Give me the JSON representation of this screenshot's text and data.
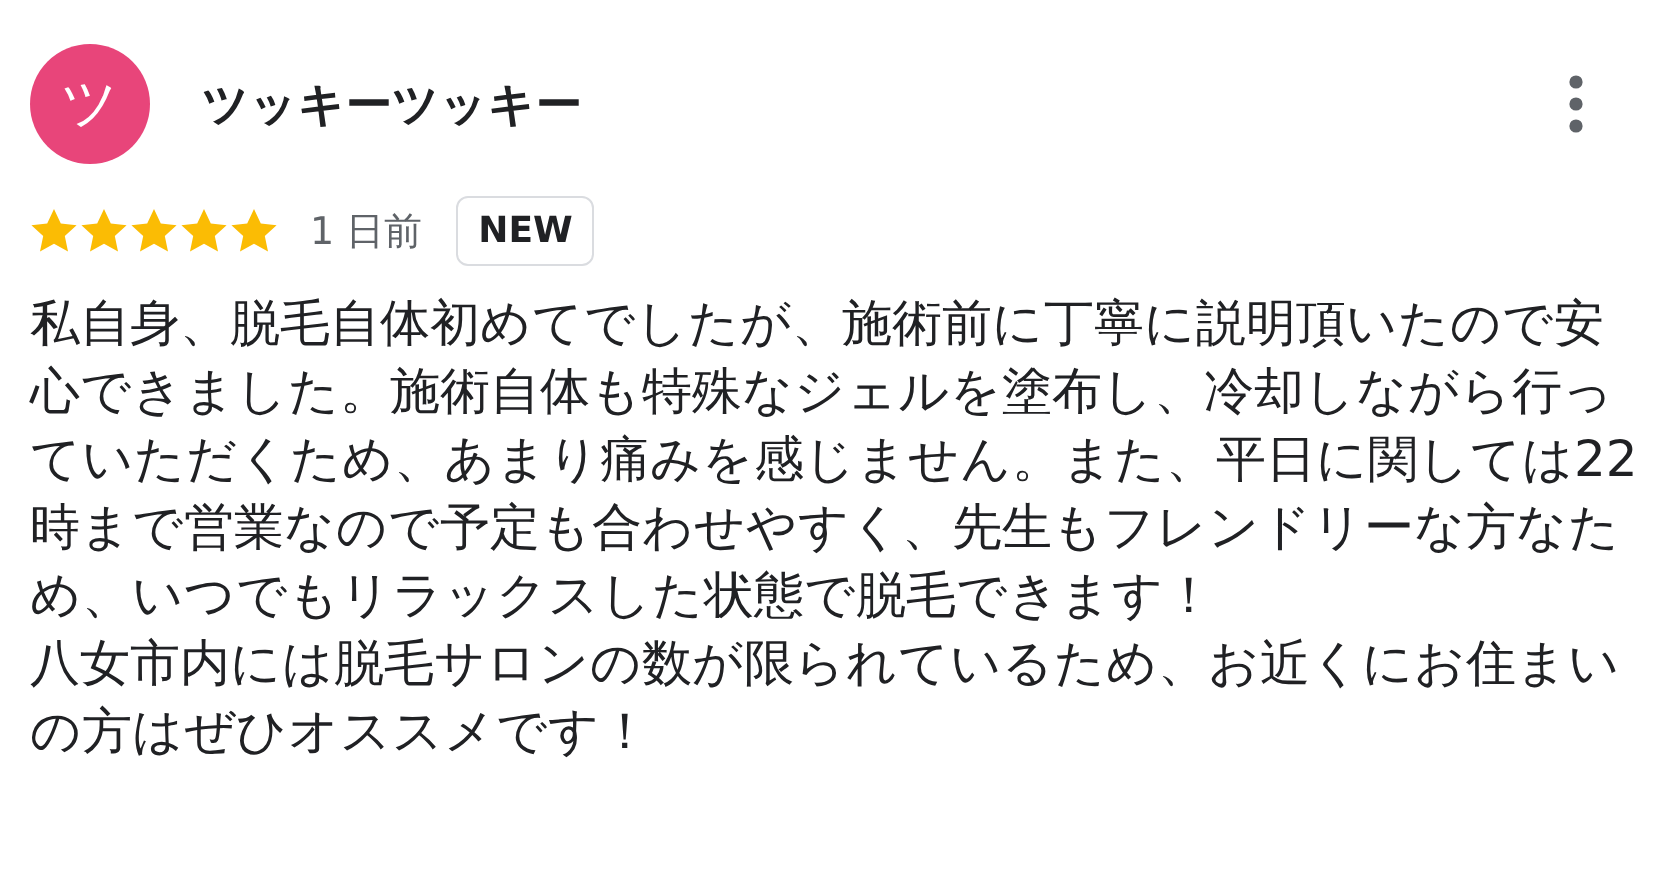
{
  "author": {
    "initial": "ツ",
    "name": "ツッキーツッキー"
  },
  "review": {
    "stars": 5,
    "time": "1 日前",
    "badge": "NEW",
    "paragraphs": [
      "私自身、脱毛自体初めてでしたが、施術前に丁寧に説明頂いたので安心できました。施術自体も特殊なジェルを塗布し、冷却しながら行っていただくため、あまり痛みを感じません。また、平日に関しては22時まで営業なので予定も合わせやすく、先生もフレンドリーな方なため、いつでもリラックスした状態で脱毛できます！",
      "八女市内には脱毛サロンの数が限られているため、お近くにお住まいの方はぜひオススメです！"
    ]
  }
}
